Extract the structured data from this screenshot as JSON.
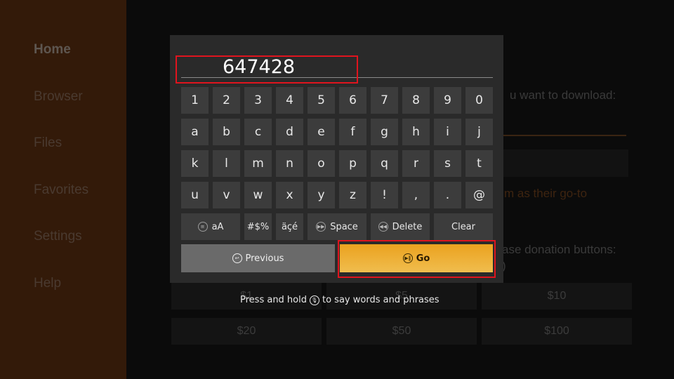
{
  "sidebar": {
    "items": [
      {
        "label": "Home",
        "active": true
      },
      {
        "label": "Browser"
      },
      {
        "label": "Files"
      },
      {
        "label": "Favorites"
      },
      {
        "label": "Settings"
      },
      {
        "label": "Help"
      }
    ]
  },
  "background": {
    "text1": "u want to download:",
    "text2": "m as their go-to",
    "text3": "ase donation buttons:",
    "text4": ")",
    "donations": [
      "$1",
      "$5",
      "$10",
      "$20",
      "$50",
      "$100"
    ]
  },
  "keyboard": {
    "input_value": "647428",
    "rows": [
      [
        "1",
        "2",
        "3",
        "4",
        "5",
        "6",
        "7",
        "8",
        "9",
        "0"
      ],
      [
        "a",
        "b",
        "c",
        "d",
        "e",
        "f",
        "g",
        "h",
        "i",
        "j"
      ],
      [
        "k",
        "l",
        "m",
        "n",
        "o",
        "p",
        "q",
        "r",
        "s",
        "t"
      ],
      [
        "u",
        "v",
        "w",
        "x",
        "y",
        "z",
        "!",
        ",",
        ".",
        "@"
      ]
    ],
    "case_label": "aA",
    "symbols_label": "#$%",
    "accents_label": "äçé",
    "space_label": "Space",
    "delete_label": "Delete",
    "clear_label": "Clear",
    "previous_label": "Previous",
    "go_label": "Go",
    "hint_before": "Press and hold",
    "hint_after": "to say words and phrases"
  },
  "colors": {
    "accent": "#eba21f",
    "highlight": "#e0141e",
    "sidebar": "#331a09"
  }
}
